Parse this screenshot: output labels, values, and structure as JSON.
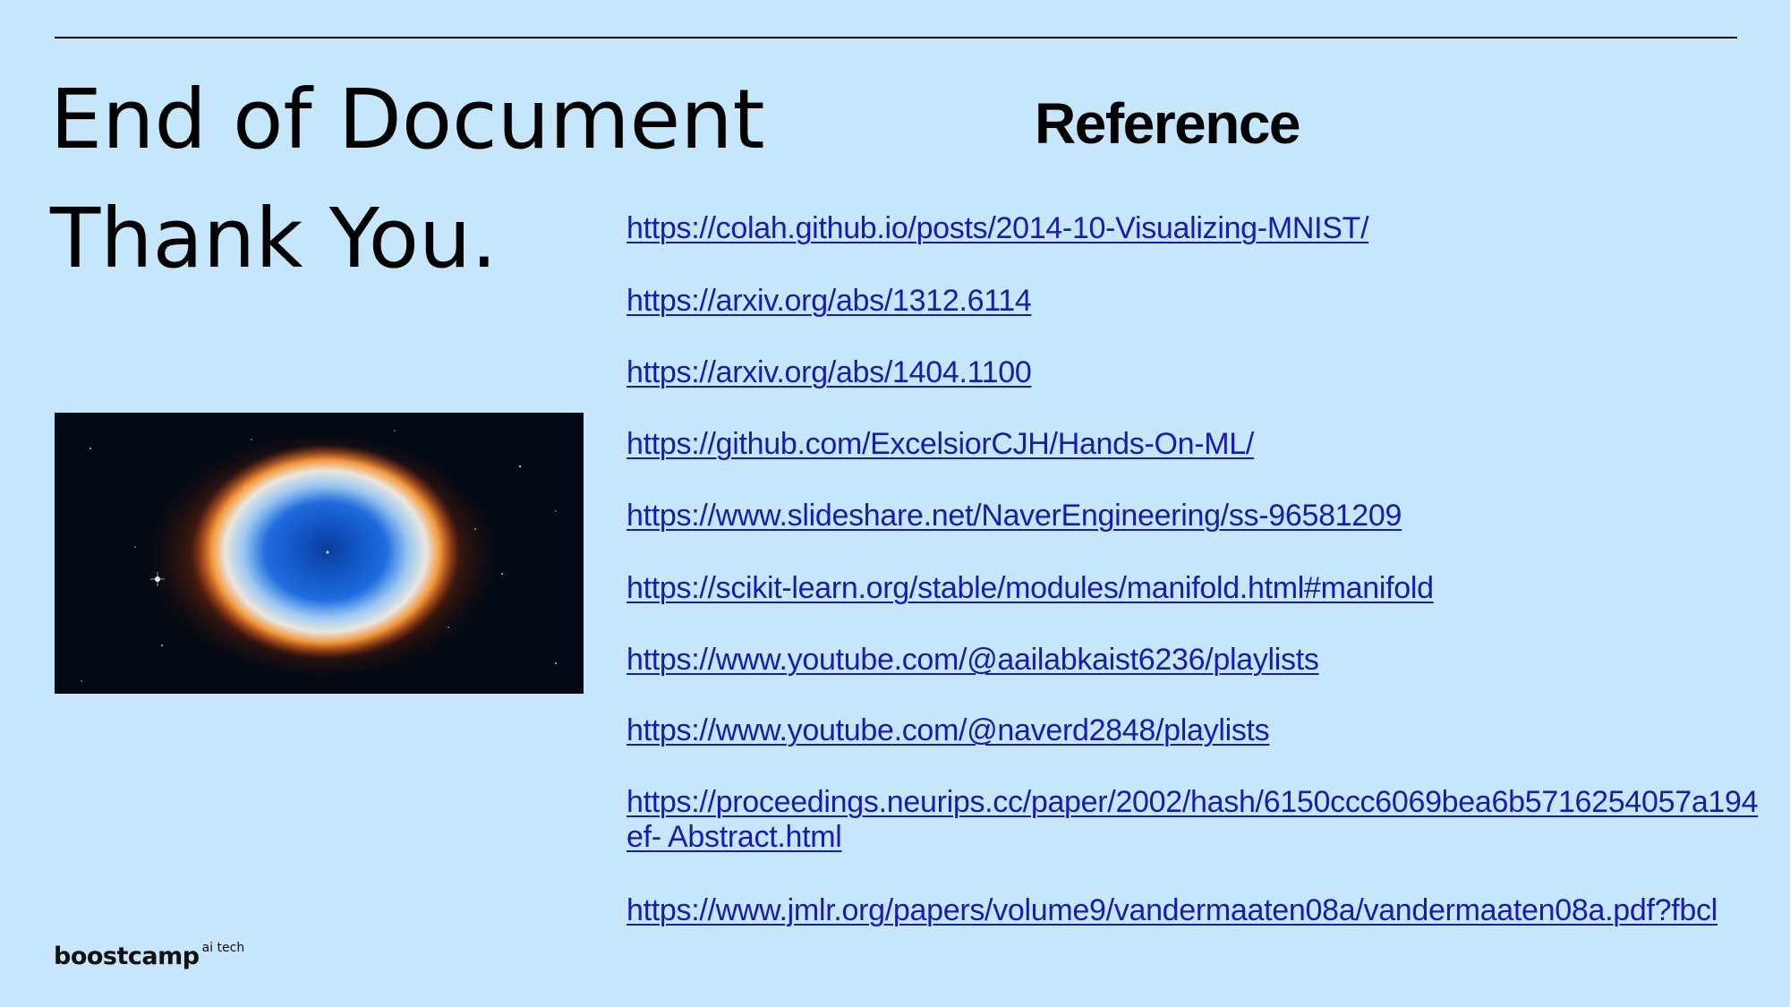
{
  "slide": {
    "title_line1": "End of Document",
    "title_line2": "Thank You.",
    "reference_heading": "Reference"
  },
  "references": [
    "https://colah.github.io/posts/2014-10-Visualizing-MNIST/",
    "https://arxiv.org/abs/1312.6114",
    "https://arxiv.org/abs/1404.1100",
    "https://github.com/ExcelsiorCJH/Hands-On-ML/",
    "https://www.slideshare.net/NaverEngineering/ss-96581209",
    "https://scikit-learn.org/stable/modules/manifold.html#manifold",
    "https://www.youtube.com/@aailabkaist6236/playlists",
    "https://www.youtube.com/@naverd2848/playlists",
    "https://proceedings.neurips.cc/paper/2002/hash/6150ccc6069bea6b5716254057a194ef- Abstract.html",
    "https://www.jmlr.org/papers/volume9/vandermaaten08a/vandermaaten08a.pdf?fbcl"
  ],
  "logo": {
    "name": "boostcamp",
    "suffix": "ai tech"
  },
  "colors": {
    "background": "#c6e7fb",
    "link": "#1a1ab0",
    "text": "#000000"
  }
}
